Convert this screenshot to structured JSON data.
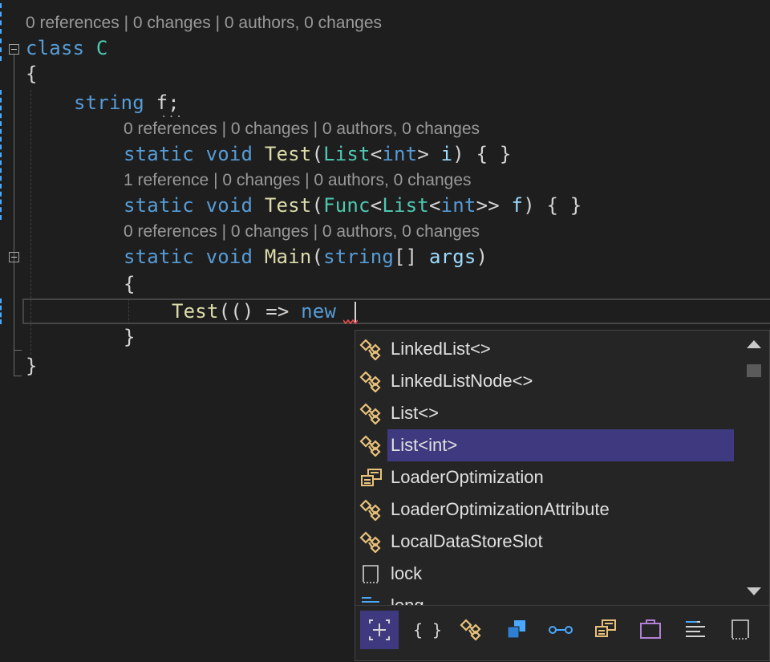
{
  "codelens": {
    "class_c": "0 references | 0 changes | 0 authors, 0 changes",
    "test_list": "0 references | 0 changes | 0 authors, 0 changes",
    "test_func": "1 reference | 0 changes | 0 authors, 0 changes",
    "main": "0 references | 0 changes | 0 authors, 0 changes"
  },
  "code": {
    "class_kw": "class",
    "class_name": "C",
    "open_brace_1": "{",
    "field_type": "string",
    "field_name": "f;",
    "m1_static": "static",
    "m1_void": "void",
    "m1_name": "Test",
    "m1_open": "(",
    "m1_type": "List",
    "m1_lt": "<",
    "m1_int": "int",
    "m1_gt": ">",
    "m1_param": " i",
    "m1_rest": ") { }",
    "m2_static": "static",
    "m2_void": "void",
    "m2_name": "Test",
    "m2_open": "(",
    "m2_func": "Func",
    "m2_lt1": "<",
    "m2_list": "List",
    "m2_lt2": "<",
    "m2_int": "int",
    "m2_gt": ">>",
    "m2_param": " f",
    "m2_rest": ") { }",
    "m3_static": "static",
    "m3_void": "void",
    "m3_name": "Main",
    "m3_open": "(",
    "m3_type": "string",
    "m3_arr": "[]",
    "m3_param": " args",
    "m3_close": ")",
    "open_brace_2": "{",
    "cur_test": "Test",
    "cur_paren": "(() => ",
    "cur_new": "new",
    "close_brace_2": "}",
    "close_brace_1": "}"
  },
  "completion": {
    "items": [
      {
        "label": "LinkedList<>",
        "icon": "class-icon"
      },
      {
        "label": "LinkedListNode<>",
        "icon": "class-icon"
      },
      {
        "label": "List<>",
        "icon": "class-icon"
      },
      {
        "label": "List<int>",
        "icon": "class-icon",
        "selected": true
      },
      {
        "label": "LoaderOptimization",
        "icon": "enum-icon"
      },
      {
        "label": "LoaderOptimizationAttribute",
        "icon": "class-icon"
      },
      {
        "label": "LocalDataStoreSlot",
        "icon": "class-icon"
      },
      {
        "label": "lock",
        "icon": "keyword-icon"
      },
      {
        "label": "long",
        "icon": "struct-icon"
      }
    ],
    "filters": [
      {
        "name": "expand-filter-icon",
        "glyph": "⌗",
        "active": true
      },
      {
        "name": "namespace-filter-icon",
        "glyph": "{ }"
      },
      {
        "name": "class-filter-icon",
        "glyph": "◈"
      },
      {
        "name": "module-filter-icon",
        "glyph": "▣"
      },
      {
        "name": "interface-filter-icon",
        "glyph": "○-○"
      },
      {
        "name": "enum-filter-icon",
        "glyph": "▤"
      },
      {
        "name": "struct-filter-icon",
        "glyph": "▭"
      },
      {
        "name": "snippet-filter-icon",
        "glyph": "☰"
      },
      {
        "name": "keyword-filter-icon",
        "glyph": "▯"
      }
    ]
  },
  "colors": {
    "background": "#1e1e1e",
    "keyword": "#569cd6",
    "type": "#4ec9b0",
    "method": "#dcdcaa",
    "parameter": "#9cdcfe",
    "selection": "#3f3a7f",
    "class_icon": "#e8c27a"
  }
}
